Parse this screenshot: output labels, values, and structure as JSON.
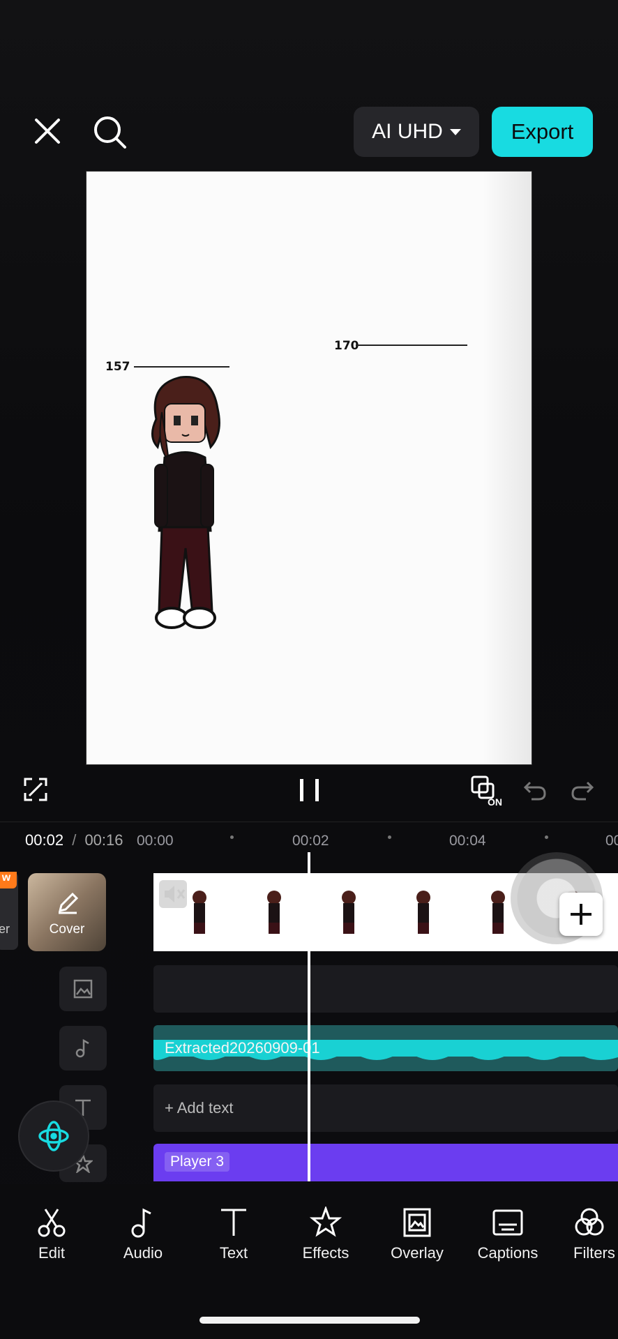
{
  "topbar": {
    "close_icon": "close-icon",
    "search_icon": "search-icon",
    "quality_label": "AI UHD",
    "export_label": "Export"
  },
  "canvas": {
    "label_left": "157",
    "label_right": "170"
  },
  "controls": {
    "fullscreen_icon": "fullscreen-icon",
    "pause_icon": "pause-icon",
    "overlay_on_label": "ON",
    "undo_icon": "undo-icon",
    "redo_icon": "redo-icon"
  },
  "timeline": {
    "current_time": "00:02",
    "separator": "/",
    "total_time": "00:16",
    "ticks": [
      "00:00",
      "00:02",
      "00:04",
      "00"
    ],
    "new_badge": "w",
    "cover_left_label": "er",
    "cover_label": "Cover",
    "audio_clip_label": "Extracted20260909-01",
    "add_text_label": "+ Add text",
    "effect_clip_label": "Player 3"
  },
  "toolbar": {
    "items": [
      {
        "label": "Edit",
        "icon": "scissors-icon"
      },
      {
        "label": "Audio",
        "icon": "music-note-icon"
      },
      {
        "label": "Text",
        "icon": "text-icon"
      },
      {
        "label": "Effects",
        "icon": "star-icon"
      },
      {
        "label": "Overlay",
        "icon": "overlay-icon"
      },
      {
        "label": "Captions",
        "icon": "captions-icon"
      },
      {
        "label": "Filters",
        "icon": "filters-icon"
      }
    ]
  },
  "colors": {
    "accent": "#18dbe1",
    "effect_track": "#6b3df0",
    "audio_wave": "#19d1d3"
  }
}
